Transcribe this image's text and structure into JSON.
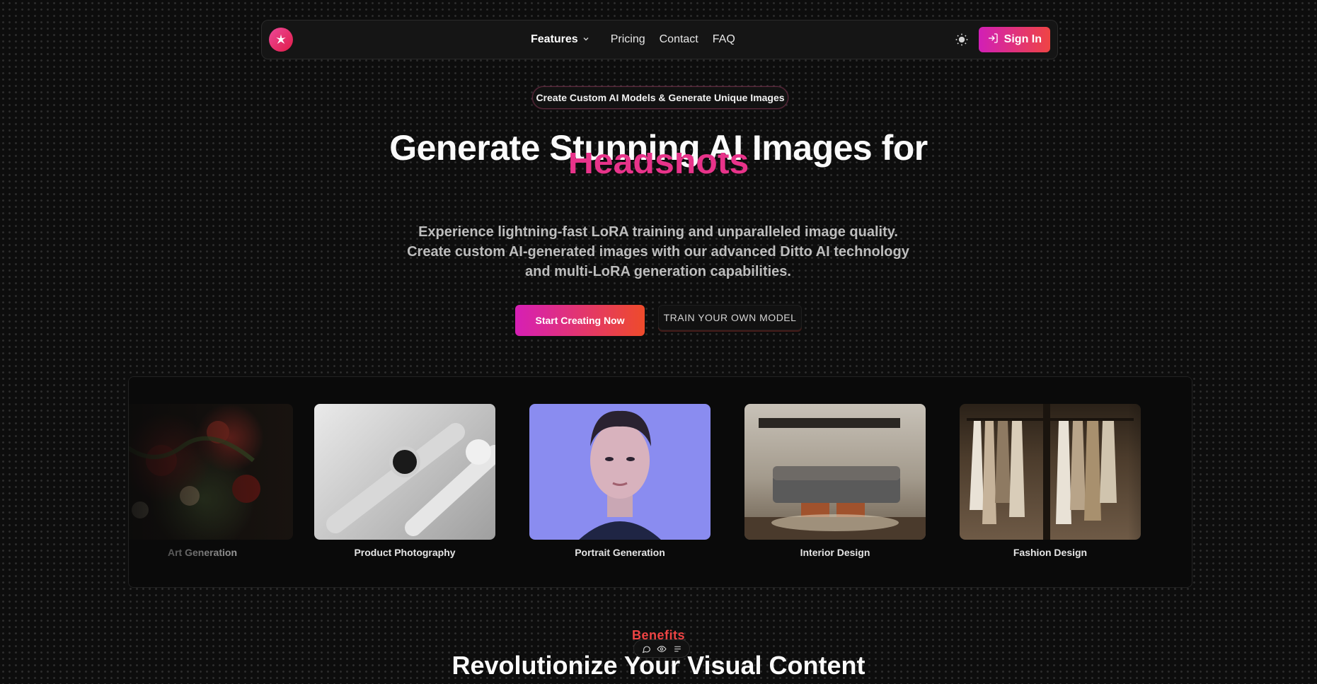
{
  "nav": {
    "logo_icon": "sparkle-logo-icon",
    "links": [
      "Features",
      "Pricing",
      "Contact",
      "FAQ"
    ],
    "features_chevron": "⌄",
    "theme_icon": "sun-icon",
    "signin_label": "Sign In"
  },
  "hero": {
    "badge": "Create Custom AI Models & Generate Unique Images",
    "title": "Generate Stunning AI Images for",
    "rotating_word": "Headshots",
    "subtitle_lines": [
      "Experience lightning-fast LoRA training and unparalleled image quality.",
      "Create custom AI-generated images with our advanced Ditto AI technology",
      "and multi-LoRA generation capabilities."
    ],
    "cta_primary": "Start Creating Now",
    "cta_secondary": "TRAIN YOUR OWN MODEL"
  },
  "showcase": [
    {
      "label": "Art Generation"
    },
    {
      "label": "Product Photography"
    },
    {
      "label": "Portrait Generation"
    },
    {
      "label": "Interior Design"
    },
    {
      "label": "Fashion Design"
    }
  ],
  "benefits": {
    "eyebrow": "Benefits",
    "title": "Revolutionize Your Visual Content"
  },
  "colors": {
    "accent_pink": "#d61fb5",
    "accent_red": "#ef4444",
    "background": "#0d0d0d"
  }
}
